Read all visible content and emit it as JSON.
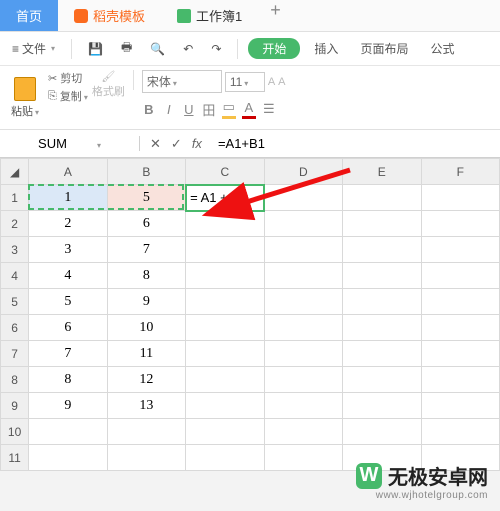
{
  "title_tabs": {
    "home": "首页",
    "template": "稻壳模板",
    "doc": "工作簿1"
  },
  "menubar": {
    "file": "文件",
    "start_pill": "开始",
    "insert": "插入",
    "page_layout": "页面布局",
    "formula": "公式"
  },
  "toolbar": {
    "cut": "剪切",
    "copy": "复制",
    "paste": "粘贴",
    "fmt_brush": "格式刷",
    "font_name": "宋体",
    "font_size": "11",
    "btn_bold": "B",
    "btn_italic": "I",
    "btn_underline": "U",
    "btn_largerA": "A",
    "btn_smallerA": "A"
  },
  "formula_bar": {
    "name_box": "SUM",
    "cancel": "✕",
    "confirm": "✓",
    "fx": "fx",
    "value": "=A1+B1"
  },
  "grid": {
    "columns": [
      "A",
      "B",
      "C",
      "D",
      "E",
      "F"
    ],
    "rows": [
      {
        "n": 1,
        "a": "1",
        "b": "5",
        "c": "= A1 + B1"
      },
      {
        "n": 2,
        "a": "2",
        "b": "6",
        "c": ""
      },
      {
        "n": 3,
        "a": "3",
        "b": "7",
        "c": ""
      },
      {
        "n": 4,
        "a": "4",
        "b": "8",
        "c": ""
      },
      {
        "n": 5,
        "a": "5",
        "b": "9",
        "c": ""
      },
      {
        "n": 6,
        "a": "6",
        "b": "10",
        "c": ""
      },
      {
        "n": 7,
        "a": "7",
        "b": "11",
        "c": ""
      },
      {
        "n": 8,
        "a": "8",
        "b": "12",
        "c": ""
      },
      {
        "n": 9,
        "a": "9",
        "b": "13",
        "c": ""
      },
      {
        "n": 10,
        "a": "",
        "b": "",
        "c": ""
      },
      {
        "n": 11,
        "a": "",
        "b": "",
        "c": ""
      }
    ]
  },
  "watermark": {
    "brand": "无极安卓网",
    "url": "www.wjhotelgroup.com"
  }
}
